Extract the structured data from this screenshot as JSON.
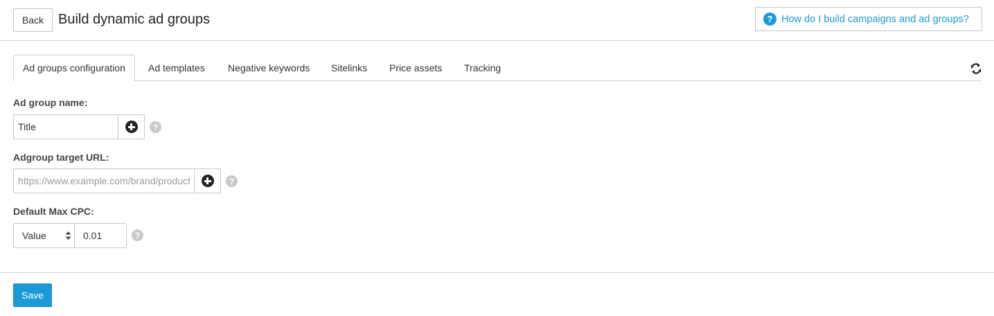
{
  "header": {
    "back_label": "Back",
    "title": "Build dynamic ad groups",
    "help_link": "How do I build campaigns and ad groups?"
  },
  "tabs": [
    {
      "label": "Ad groups configuration",
      "active": true
    },
    {
      "label": "Ad templates",
      "active": false
    },
    {
      "label": "Negative keywords",
      "active": false
    },
    {
      "label": "Sitelinks",
      "active": false
    },
    {
      "label": "Price assets",
      "active": false
    },
    {
      "label": "Tracking",
      "active": false
    }
  ],
  "form": {
    "ad_group_name": {
      "label": "Ad group name:",
      "value": "Title"
    },
    "target_url": {
      "label": "Adgroup target URL:",
      "placeholder": "https://www.example.com/brand/product",
      "value": ""
    },
    "max_cpc": {
      "label": "Default Max CPC:",
      "mode": "Value",
      "value": "0.01"
    }
  },
  "footer": {
    "save_label": "Save"
  },
  "colors": {
    "accent": "#1a9ad6",
    "border": "#c8c8c8",
    "help_icon": "#c9c9c9"
  }
}
